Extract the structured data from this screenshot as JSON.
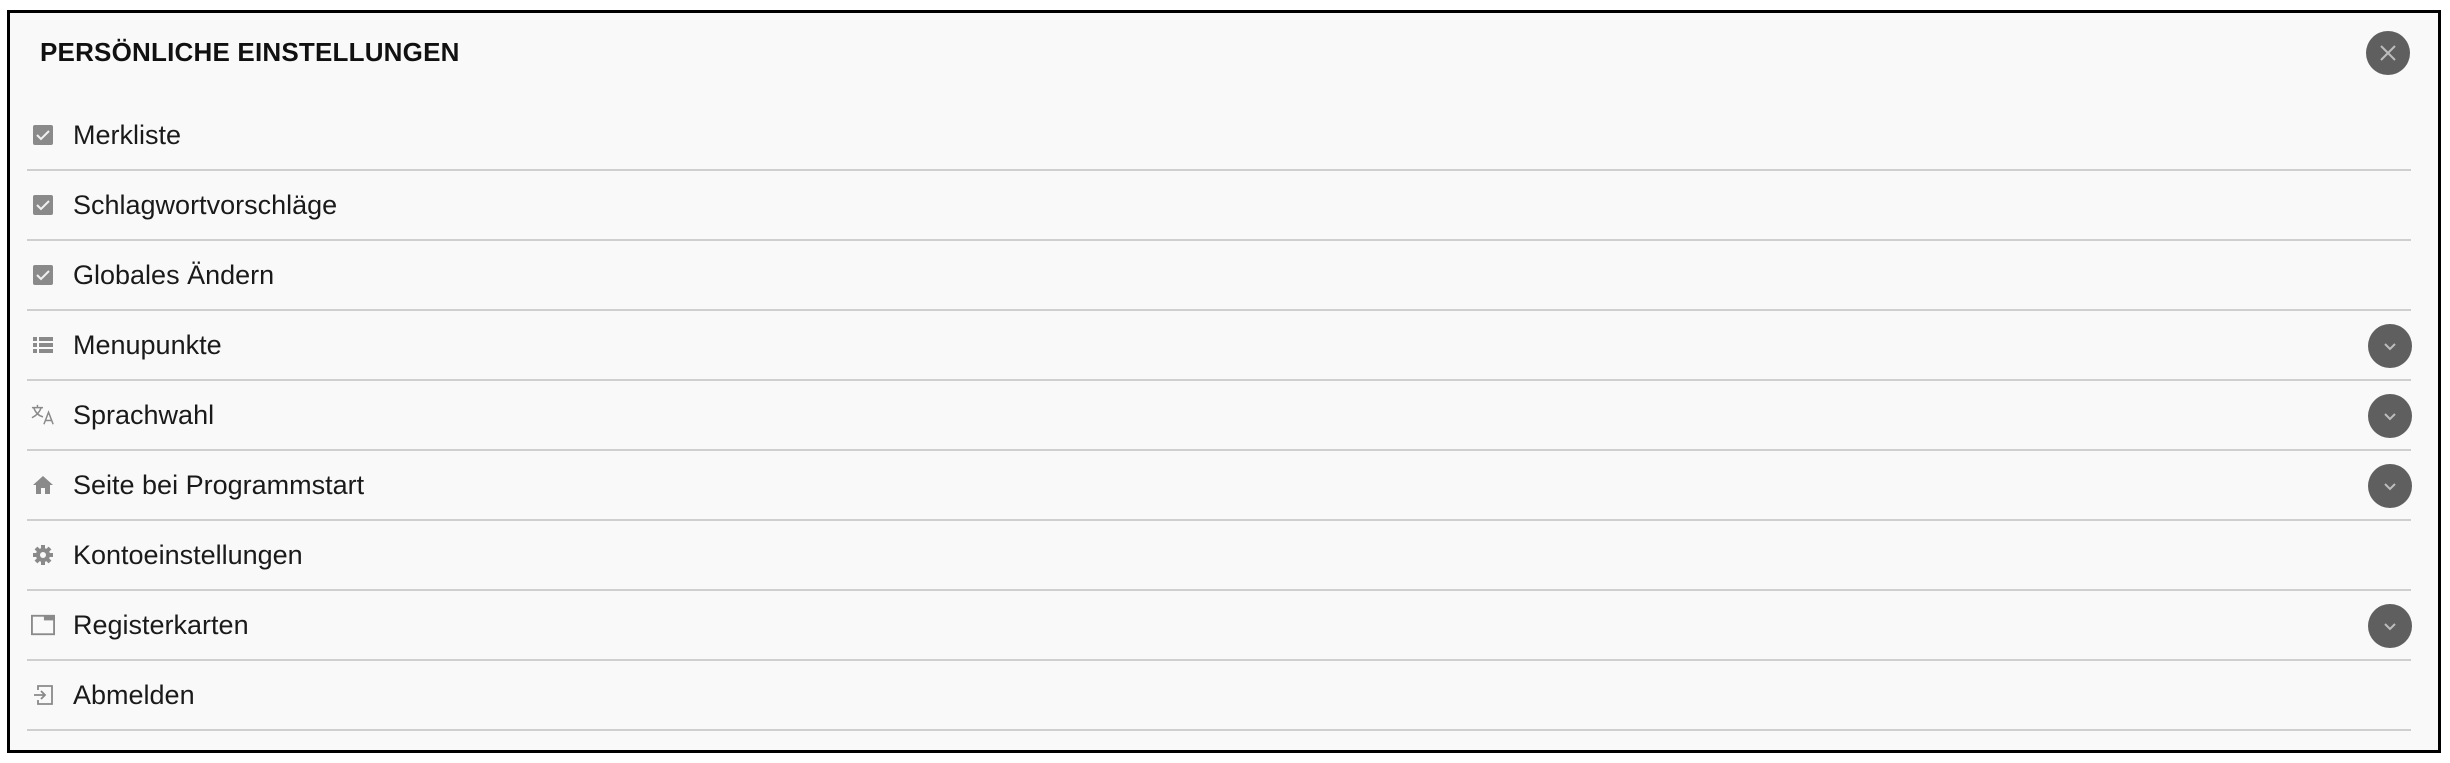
{
  "header": {
    "title": "PERSÖNLICHE EINSTELLUNGEN"
  },
  "items": [
    {
      "label": "Merkliste",
      "icon": "checkbox-checked-icon",
      "checked": true
    },
    {
      "label": "Schlagwortvorschläge",
      "icon": "checkbox-checked-icon",
      "checked": true
    },
    {
      "label": "Globales Ändern",
      "icon": "checkbox-checked-icon",
      "checked": true
    },
    {
      "label": "Menupunkte",
      "icon": "list-icon",
      "expandable": true
    },
    {
      "label": "Sprachwahl",
      "icon": "translate-icon",
      "expandable": true
    },
    {
      "label": "Seite bei Programmstart",
      "icon": "home-icon",
      "expandable": true
    },
    {
      "label": "Kontoeinstellungen",
      "icon": "gear-icon"
    },
    {
      "label": "Registerkarten",
      "icon": "tab-icon",
      "expandable": true
    },
    {
      "label": "Abmelden",
      "icon": "logout-icon"
    }
  ],
  "colors": {
    "icon": "#8a8a8a",
    "button": "#5f5f5f",
    "divider": "#cfcfcf",
    "background": "#f9f9f9"
  }
}
